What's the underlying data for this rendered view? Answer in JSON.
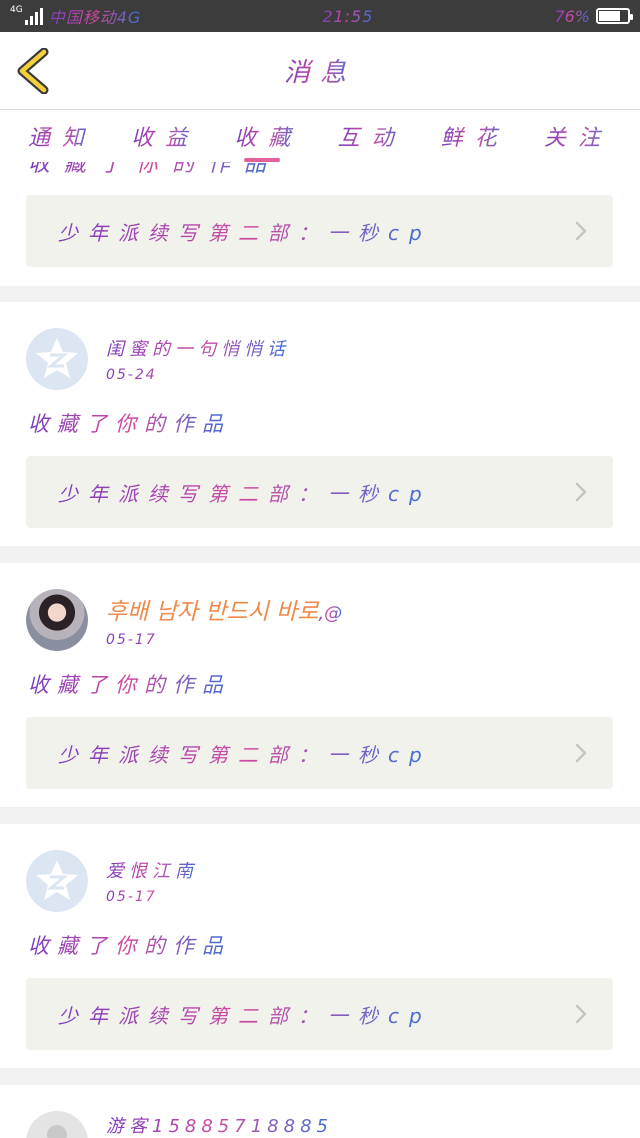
{
  "status_bar": {
    "network": "4G",
    "carrier": "中国移动4G",
    "time": "21:55",
    "battery": "76%",
    "battery_level": 0.76
  },
  "header": {
    "title": "消息"
  },
  "tabs": [
    {
      "label": "通知",
      "active": false
    },
    {
      "label": "收益",
      "active": false
    },
    {
      "label": "收藏",
      "active": true
    },
    {
      "label": "互动",
      "active": false
    },
    {
      "label": "鲜花",
      "active": false
    },
    {
      "label": "关注",
      "active": false
    }
  ],
  "work_title": "少年派续写第二部：一秒cp",
  "partial_card": {
    "cut_text": "收藏了你的作品"
  },
  "messages": [
    {
      "name": "闺蜜的一句悄悄话",
      "date": "05-24",
      "action": "收藏了你的作品"
    },
    {
      "name": "후배 남자 반드시 바로",
      "name_suffix": ",@",
      "date": "05-17",
      "action": "收藏了你的作品"
    },
    {
      "name": "爱恨江南",
      "date": "05-17",
      "action": "收藏了你的作品"
    },
    {
      "name": "游客15885718885",
      "date": "",
      "action": ""
    }
  ]
}
